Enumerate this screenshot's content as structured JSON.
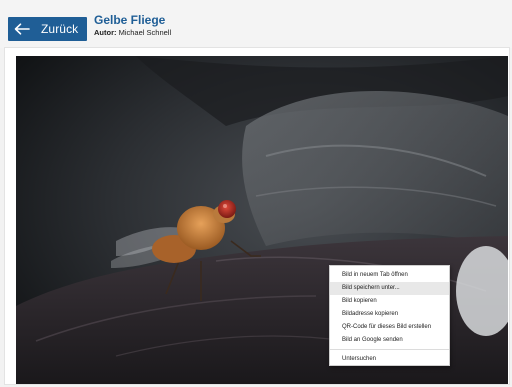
{
  "header": {
    "back_label": "Zurück",
    "title": "Gelbe Fliege",
    "author_label": "Autor:",
    "author_name": "Michael Schnell"
  },
  "context_menu": {
    "items": [
      "Bild in neuem Tab öffnen",
      "Bild speichern unter...",
      "Bild kopieren",
      "Bildadresse kopieren",
      "QR-Code für dieses Bild erstellen",
      "Bild an Google senden",
      "Untersuchen"
    ],
    "highlighted_index": 1
  },
  "icons": {
    "back": "arrow-left-icon"
  },
  "colors": {
    "accent": "#1f5e96",
    "menu_highlight": "#e8e8e8"
  }
}
